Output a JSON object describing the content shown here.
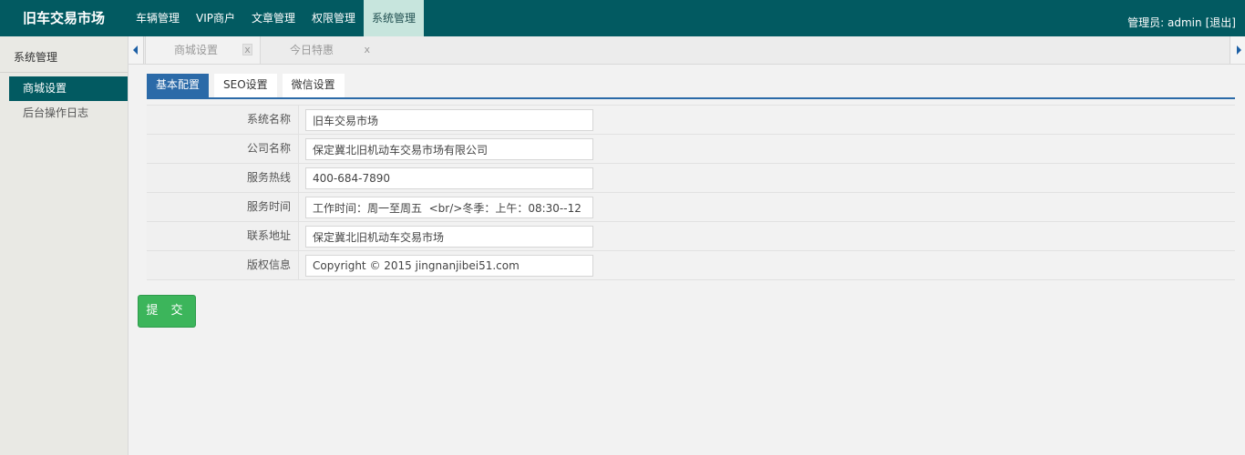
{
  "header": {
    "brand": "旧车交易市场",
    "nav": [
      {
        "label": "车辆管理"
      },
      {
        "label": "VIP商户"
      },
      {
        "label": "文章管理"
      },
      {
        "label": "权限管理"
      },
      {
        "label": "系统管理",
        "active": true
      }
    ],
    "admin_label": "管理员: admin",
    "logout_label": "[退出]"
  },
  "sidebar": {
    "title": "系统管理",
    "items": [
      {
        "label": "商城设置",
        "active": true
      },
      {
        "label": "后台操作日志"
      }
    ]
  },
  "tabstrip": {
    "tabs": [
      {
        "label": "商城设置",
        "close": "x",
        "active": true
      },
      {
        "label": "今日特惠",
        "close": "x"
      }
    ]
  },
  "config_tabs": [
    {
      "label": "基本配置",
      "active": true
    },
    {
      "label": "SEO设置"
    },
    {
      "label": "微信设置"
    }
  ],
  "form": {
    "rows": [
      {
        "label": "系统名称",
        "value": "旧车交易市场"
      },
      {
        "label": "公司名称",
        "value": "保定冀北旧机动车交易市场有限公司"
      },
      {
        "label": "服务热线",
        "value": "400-684-7890"
      },
      {
        "label": "服务时间",
        "value": "工作时间：周一至周五  <br/>冬季：上午：08:30--12"
      },
      {
        "label": "联系地址",
        "value": "保定冀北旧机动车交易市场"
      },
      {
        "label": "版权信息",
        "value": "Copyright © 2015 jingnanjibei51.com"
      }
    ],
    "submit_label": "提 交"
  },
  "colors": {
    "header_bg": "#025a61",
    "nav_active_bg": "#c7e5dd",
    "config_tab_active": "#2b6aa8",
    "submit_bg": "#3cb55b"
  }
}
